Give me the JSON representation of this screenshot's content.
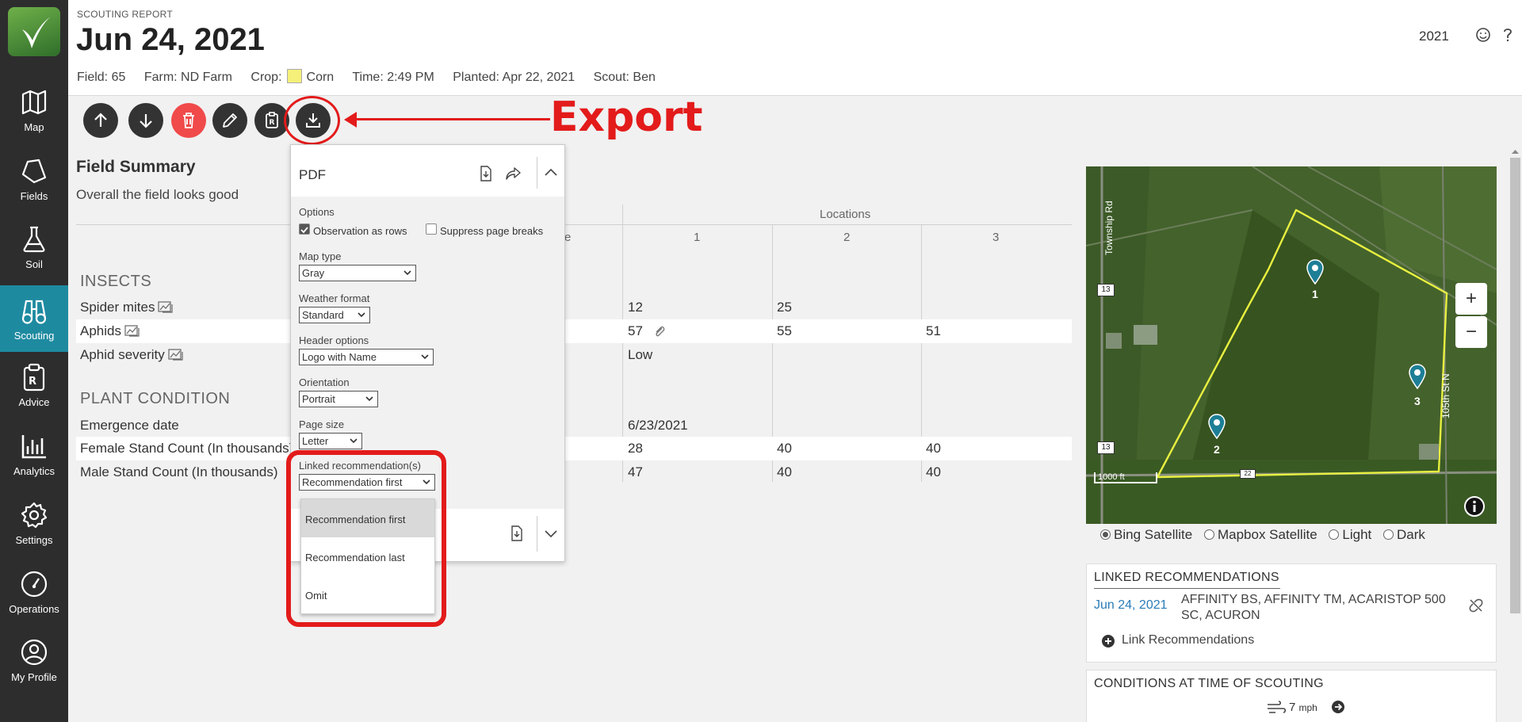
{
  "sidebar": {
    "items": [
      {
        "label": "Map"
      },
      {
        "label": "Fields"
      },
      {
        "label": "Soil"
      },
      {
        "label": "Scouting"
      },
      {
        "label": "Advice"
      },
      {
        "label": "Analytics"
      },
      {
        "label": "Settings"
      },
      {
        "label": "Operations"
      },
      {
        "label": "My Profile"
      }
    ]
  },
  "header": {
    "kicker": "SCOUTING REPORT",
    "title": "Jun 24, 2021",
    "field": "Field: 65",
    "farm": "Farm: ND Farm",
    "crop_label": "Crop:",
    "crop": "Corn",
    "time": "Time: 2:49 PM",
    "planted": "Planted: Apr 22, 2021",
    "scout": "Scout: Ben",
    "year": "2021"
  },
  "annotation": {
    "label": "Export"
  },
  "summary": {
    "title": "Field Summary",
    "text": "Overall the field looks good",
    "locations_header": "Locations",
    "col_partial": "e",
    "location_cols": [
      "1",
      "2",
      "3"
    ]
  },
  "sections": {
    "insects": "INSECTS",
    "plant": "PLANT CONDITION"
  },
  "rows": [
    {
      "name": "Spider mites",
      "v1": "12",
      "v2": "25",
      "v3": ""
    },
    {
      "name": "Aphids",
      "v1": "57",
      "v2": "55",
      "v3": "51"
    },
    {
      "name": "Aphid severity",
      "v1": "Low",
      "v2": "",
      "v3": ""
    },
    {
      "name": "Emergence date",
      "v1": "6/23/2021",
      "v2": "",
      "v3": ""
    },
    {
      "name": "Female Stand Count (In thousands)",
      "v1": "28",
      "v2": "40",
      "v3": "40"
    },
    {
      "name": "Male Stand Count (In thousands)",
      "v1": "47",
      "v2": "40",
      "v3": "40"
    }
  ],
  "export_panel": {
    "title": "PDF",
    "options_label": "Options",
    "obs_as_rows": "Observation as rows",
    "suppress_breaks": "Suppress page breaks",
    "map_type_label": "Map type",
    "map_type": "Gray",
    "weather_label": "Weather format",
    "weather": "Standard",
    "header_label": "Header options",
    "header_value": "Logo with Name",
    "orientation_label": "Orientation",
    "orientation": "Portrait",
    "page_size_label": "Page size",
    "page_size": "Letter",
    "linked_label": "Linked recommendation(s)",
    "linked_value": "Recommendation first",
    "linked_options": [
      "Recommendation first",
      "Recommendation last",
      "Omit"
    ]
  },
  "map": {
    "road_top": "Township Rd",
    "road_right": "105th St N",
    "scale": "1000 ft",
    "shield_13a": "13",
    "shield_13b": "13",
    "shield_22": "22",
    "pins": [
      "1",
      "2",
      "3"
    ],
    "zoom_in": "+",
    "zoom_out": "−",
    "layers": [
      "Bing Satellite",
      "Mapbox Satellite",
      "Light",
      "Dark"
    ]
  },
  "linked_recs": {
    "title": "LINKED RECOMMENDATIONS",
    "date": "Jun 24, 2021",
    "products": "AFFINITY BS, AFFINITY TM, ACARISTOP 500 SC, ACURON",
    "add_label": "Link Recommendations"
  },
  "conditions": {
    "title": "CONDITIONS AT TIME OF SCOUTING",
    "wind_value": "7",
    "wind_unit": "mph"
  }
}
